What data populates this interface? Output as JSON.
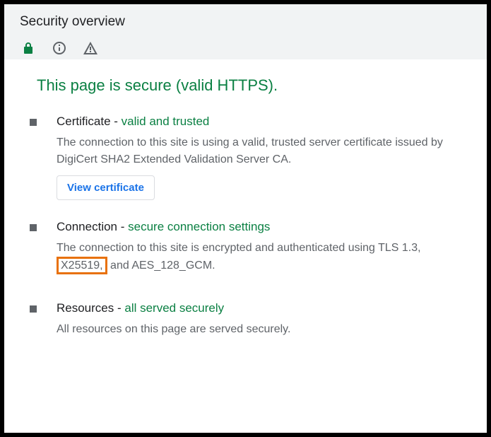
{
  "header": {
    "title": "Security overview"
  },
  "main": {
    "headline": "This page is secure (valid HTTPS)."
  },
  "sections": {
    "certificate": {
      "label": "Certificate - ",
      "status": "valid and trusted",
      "desc": "The connection to this site is using a valid, trusted server certificate issued by DigiCert SHA2 Extended Validation Server CA.",
      "button": "View certificate"
    },
    "connection": {
      "label": "Connection - ",
      "status": "secure connection settings",
      "desc_pre": "The connection to this site is encrypted and authenticated using TLS 1.3, ",
      "highlighted": "X25519,",
      "desc_post": " and AES_128_GCM."
    },
    "resources": {
      "label": "Resources - ",
      "status": "all served securely",
      "desc": "All resources on this page are served securely."
    }
  }
}
